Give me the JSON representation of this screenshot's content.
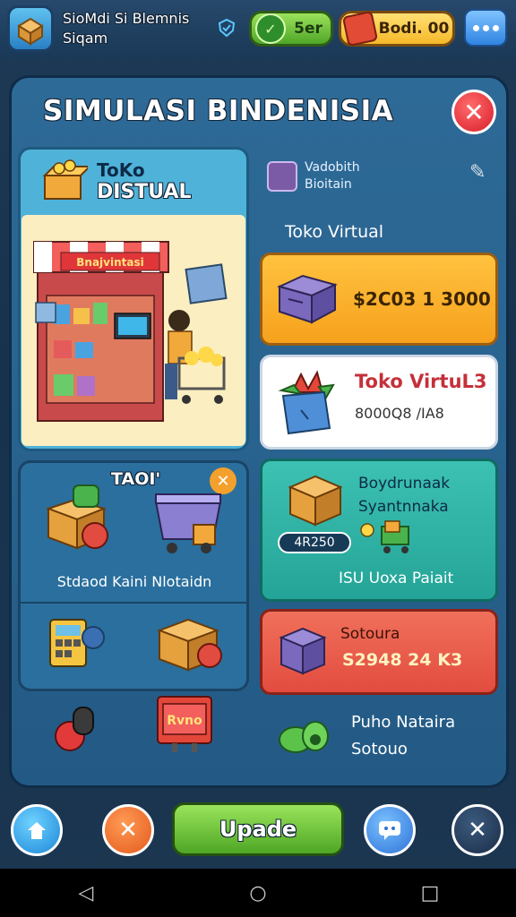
{
  "header": {
    "title": "SioMdi Si Blemnis Siqam",
    "cash": "5er",
    "gold": "Bodi. 00"
  },
  "panel": {
    "title": "SIMULASI BINDENISIA"
  },
  "store_card": {
    "title_line1": "ToKo",
    "title_line2": "DISTUAL",
    "sign": "Bnajvintasi"
  },
  "vendor": {
    "line1": "Vadobith",
    "line2": "Bioitain"
  },
  "store_subtitle": "Toko Virtual",
  "offers": {
    "orange_price": "$2C03 1 3000",
    "white_title": "Toko VirtuL3",
    "white_value": "8000Q8 /IA8"
  },
  "tool_card": {
    "title": "TAOI'",
    "label": "Stdaod Kaini Nlotaidn"
  },
  "teal_card": {
    "title_line1": "Boydrunaak",
    "title_line2": "Syantnnaka",
    "badge": "4R250",
    "label": "ISU Uoxa Paiait"
  },
  "red_card": {
    "title": "Sotoura",
    "value": "S2948 24 K3"
  },
  "bottom_item": {
    "sign": "Rvno",
    "label_line1": "Puho Nataira",
    "label_line2": "Sotouo"
  },
  "bottom_bar": {
    "upgrade": "Upade"
  },
  "colors": {
    "panel": "#2e6a97",
    "accent_green": "#4ea625",
    "accent_orange": "#f6a11c",
    "accent_red": "#e24c3f",
    "accent_teal": "#24a497"
  }
}
